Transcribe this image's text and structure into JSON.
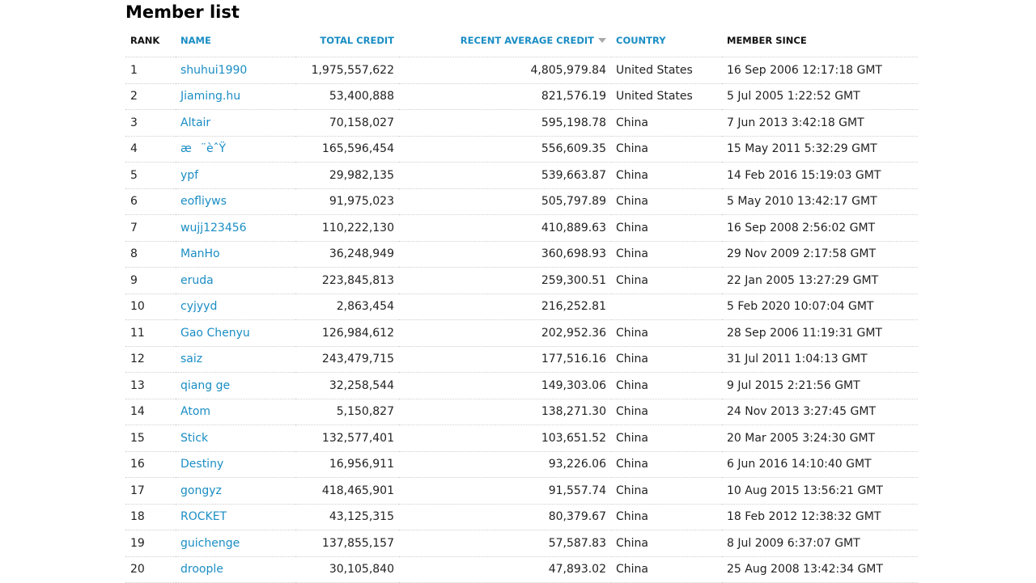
{
  "page": {
    "title": "Member list"
  },
  "columns": {
    "rank": "RANK",
    "name": "NAME",
    "total_credit": "TOTAL CREDIT",
    "recent_average_credit": "RECENT AVERAGE CREDIT",
    "country": "COUNTRY",
    "member_since": "MEMBER SINCE"
  },
  "sort": {
    "column": "recent_average_credit",
    "direction": "descending",
    "icon": "sort-descending-icon"
  },
  "colors": {
    "link": "#1a8dc4",
    "text": "#222222",
    "divider": "#cfcfcf",
    "sort_arrow": "#a9a9a9"
  },
  "rows": [
    {
      "rank": "1",
      "name": "shuhui1990",
      "total_credit": "1,975,557,622",
      "recent_average_credit": "4,805,979.84",
      "country": "United States",
      "member_since": "16 Sep 2006 12:17:18 GMT"
    },
    {
      "rank": "2",
      "name": "Jiaming.hu",
      "total_credit": "53,400,888",
      "recent_average_credit": "821,576.19",
      "country": "United States",
      "member_since": "5 Jul 2005 1:22:52 GMT"
    },
    {
      "rank": "3",
      "name": "Altair",
      "total_credit": "70,158,027",
      "recent_average_credit": "595,198.78",
      "country": "China",
      "member_since": "7 Jun 2013 3:42:18 GMT"
    },
    {
      "rank": "4",
      "name": "æ¨èˆŸ",
      "total_credit": "165,596,454",
      "recent_average_credit": "556,609.35",
      "country": "China",
      "member_since": "15 May 2011 5:32:29 GMT"
    },
    {
      "rank": "5",
      "name": "ypf",
      "total_credit": "29,982,135",
      "recent_average_credit": "539,663.87",
      "country": "China",
      "member_since": "14 Feb 2016 15:19:03 GMT"
    },
    {
      "rank": "6",
      "name": "eofliyws",
      "total_credit": "91,975,023",
      "recent_average_credit": "505,797.89",
      "country": "China",
      "member_since": "5 May 2010 13:42:17 GMT"
    },
    {
      "rank": "7",
      "name": "wujj123456",
      "total_credit": "110,222,130",
      "recent_average_credit": "410,889.63",
      "country": "China",
      "member_since": "16 Sep 2008 2:56:02 GMT"
    },
    {
      "rank": "8",
      "name": "ManHo",
      "total_credit": "36,248,949",
      "recent_average_credit": "360,698.93",
      "country": "China",
      "member_since": "29 Nov 2009 2:17:58 GMT"
    },
    {
      "rank": "9",
      "name": "eruda",
      "total_credit": "223,845,813",
      "recent_average_credit": "259,300.51",
      "country": "China",
      "member_since": "22 Jan 2005 13:27:29 GMT"
    },
    {
      "rank": "10",
      "name": "cyjyyd",
      "total_credit": "2,863,454",
      "recent_average_credit": "216,252.81",
      "country": "",
      "member_since": "5 Feb 2020 10:07:04 GMT"
    },
    {
      "rank": "11",
      "name": "Gao Chenyu",
      "total_credit": "126,984,612",
      "recent_average_credit": "202,952.36",
      "country": "China",
      "member_since": "28 Sep 2006 11:19:31 GMT"
    },
    {
      "rank": "12",
      "name": "saiz",
      "total_credit": "243,479,715",
      "recent_average_credit": "177,516.16",
      "country": "China",
      "member_since": "31 Jul 2011 1:04:13 GMT"
    },
    {
      "rank": "13",
      "name": "qiang ge",
      "total_credit": "32,258,544",
      "recent_average_credit": "149,303.06",
      "country": "China",
      "member_since": "9 Jul 2015 2:21:56 GMT"
    },
    {
      "rank": "14",
      "name": "Atom",
      "total_credit": "5,150,827",
      "recent_average_credit": "138,271.30",
      "country": "China",
      "member_since": "24 Nov 2013 3:27:45 GMT"
    },
    {
      "rank": "15",
      "name": "Stick",
      "total_credit": "132,577,401",
      "recent_average_credit": "103,651.52",
      "country": "China",
      "member_since": "20 Mar 2005 3:24:30 GMT"
    },
    {
      "rank": "16",
      "name": "Destiny",
      "total_credit": "16,956,911",
      "recent_average_credit": "93,226.06",
      "country": "China",
      "member_since": "6 Jun 2016 14:10:40 GMT"
    },
    {
      "rank": "17",
      "name": "gongyz",
      "total_credit": "418,465,901",
      "recent_average_credit": "91,557.74",
      "country": "China",
      "member_since": "10 Aug 2015 13:56:21 GMT"
    },
    {
      "rank": "18",
      "name": "ROCKET",
      "total_credit": "43,125,315",
      "recent_average_credit": "80,379.67",
      "country": "China",
      "member_since": "18 Feb 2012 12:38:32 GMT"
    },
    {
      "rank": "19",
      "name": "guichenge",
      "total_credit": "137,855,157",
      "recent_average_credit": "57,587.83",
      "country": "China",
      "member_since": "8 Jul 2009 6:37:07 GMT"
    },
    {
      "rank": "20",
      "name": "droople",
      "total_credit": "30,105,840",
      "recent_average_credit": "47,893.02",
      "country": "China",
      "member_since": "25 Aug 2008 13:42:34 GMT"
    }
  ]
}
